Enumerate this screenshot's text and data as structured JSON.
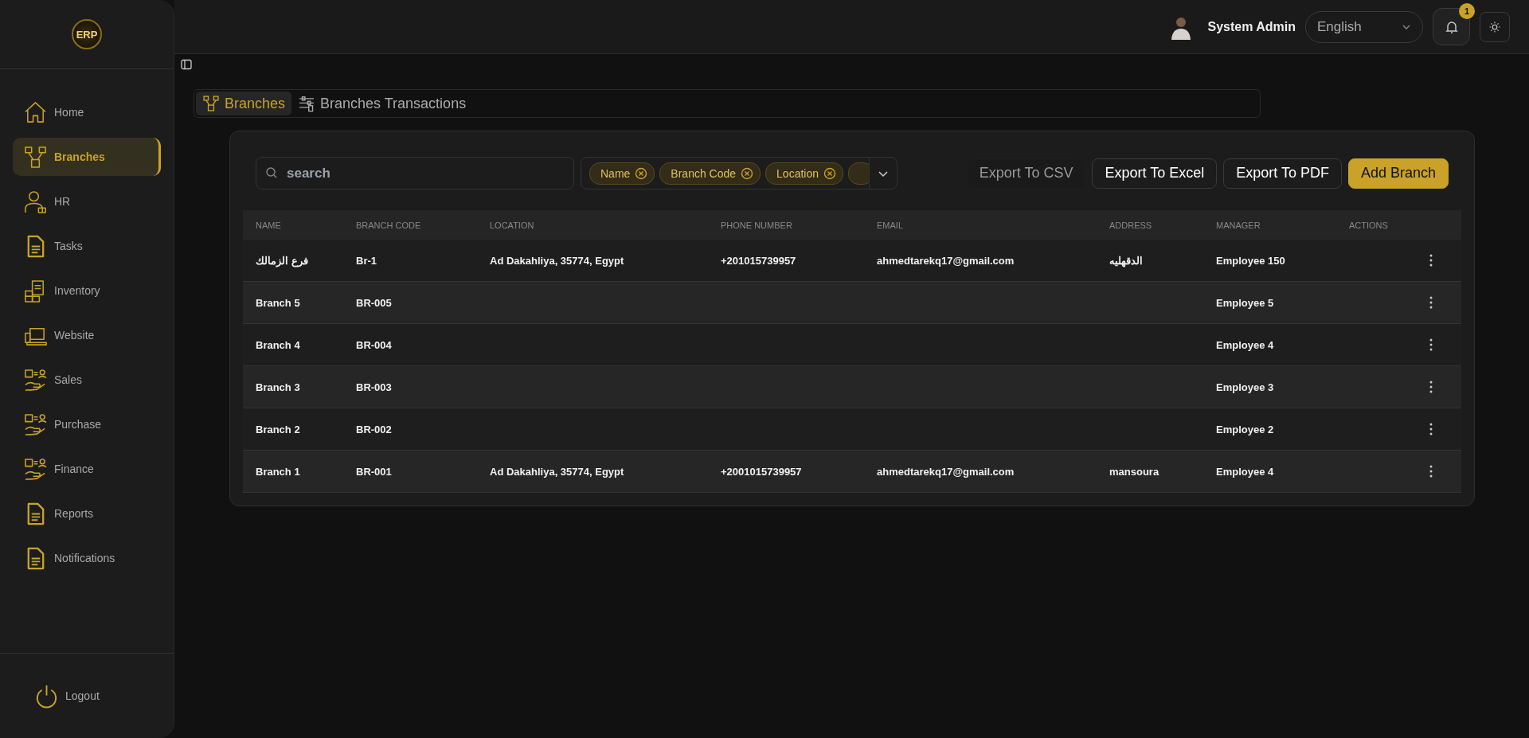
{
  "sidebar": {
    "logo": "ERP",
    "items": [
      {
        "label": "Home",
        "selected": false
      },
      {
        "label": "Branches",
        "selected": true
      },
      {
        "label": "HR",
        "selected": false
      },
      {
        "label": "Tasks",
        "selected": false
      },
      {
        "label": "Inventory",
        "selected": false
      },
      {
        "label": "Website",
        "selected": false
      },
      {
        "label": "Sales",
        "selected": false
      },
      {
        "label": "Purchase",
        "selected": false
      },
      {
        "label": "Finance",
        "selected": false
      },
      {
        "label": "Reports",
        "selected": false
      },
      {
        "label": "Notifications",
        "selected": false
      }
    ],
    "logout": "Logout"
  },
  "header": {
    "user_name": "System Admin",
    "language": "English",
    "notification_count": "1"
  },
  "tabs": [
    {
      "label": "Branches",
      "selected": true
    },
    {
      "label": "Branches Transactions",
      "selected": false
    }
  ],
  "toolbar": {
    "search": {
      "placeholder": "search"
    },
    "filter_chips": [
      "Name",
      "Branch Code",
      "Location"
    ],
    "buttons": [
      {
        "label": "Export To CSV",
        "kind": "ghost"
      },
      {
        "label": "Export To Excel",
        "kind": "outline"
      },
      {
        "label": "Export To PDF",
        "kind": "outline"
      },
      {
        "label": "Add Branch",
        "kind": "primary"
      }
    ]
  },
  "table": {
    "columns": [
      "NAME",
      "BRANCH CODE",
      "LOCATION",
      "PHONE NUMBER",
      "EMAIL",
      "ADDRESS",
      "MANAGER",
      "ACTIONS"
    ],
    "rows": [
      [
        "فرع الزمالك",
        "Br-1",
        "Ad Dakahliya, 35774, Egypt",
        "+201015739957",
        "ahmedtarekq17@gmail.com",
        "الدقهليه",
        "Employee 150"
      ],
      [
        "Branch 5",
        "BR-005",
        "",
        "",
        "",
        "",
        "Employee 5"
      ],
      [
        "Branch 4",
        "BR-004",
        "",
        "",
        "",
        "",
        "Employee 4"
      ],
      [
        "Branch 3",
        "BR-003",
        "",
        "",
        "",
        "",
        "Employee 3"
      ],
      [
        "Branch 2",
        "BR-002",
        "",
        "",
        "",
        "",
        "Employee 2"
      ],
      [
        "Branch 1",
        "BR-001",
        "Ad Dakahliya, 35774, Egypt",
        "+2001015739957",
        "ahmedtarekq17@gmail.com",
        "mansoura",
        "Employee 4"
      ]
    ]
  }
}
